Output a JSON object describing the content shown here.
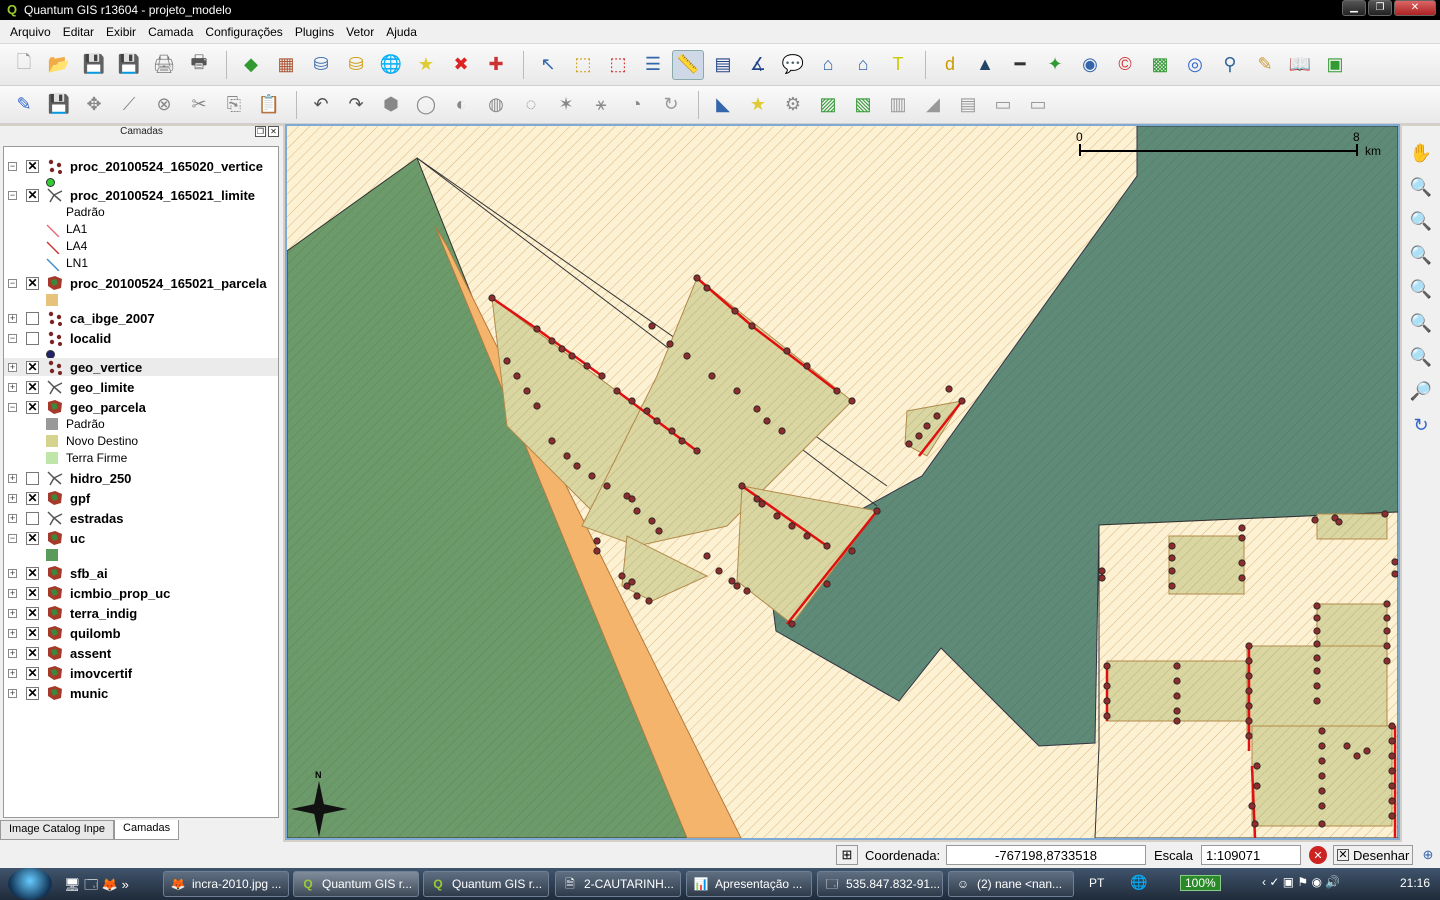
{
  "window": {
    "title": "Quantum GIS r13604 - projeto_modelo",
    "app_icon": "Q"
  },
  "menu": [
    "Arquivo",
    "Editar",
    "Exibir",
    "Camada",
    "Configurações",
    "Plugins",
    "Vetor",
    "Ajuda"
  ],
  "layers_panel": {
    "title": "Camadas",
    "layers": [
      {
        "name": "proc_20100524_165020_vertice",
        "checked": true,
        "expanded": true,
        "icon": "point"
      },
      {
        "name": "proc_20100524_165021_limite",
        "checked": true,
        "expanded": true,
        "icon": "line"
      },
      {
        "name": "proc_20100524_165021_parcela",
        "checked": true,
        "expanded": true,
        "icon": "polygon"
      },
      {
        "name": "ca_ibge_2007",
        "checked": false,
        "expanded": false,
        "icon": "point"
      },
      {
        "name": "localid",
        "checked": false,
        "expanded": true,
        "icon": "point"
      },
      {
        "name": "geo_vertice",
        "checked": true,
        "expanded": false,
        "icon": "point"
      },
      {
        "name": "geo_limite",
        "checked": true,
        "expanded": false,
        "icon": "line"
      },
      {
        "name": "geo_parcela",
        "checked": true,
        "expanded": true,
        "icon": "polygon"
      },
      {
        "name": "hidro_250",
        "checked": false,
        "expanded": false,
        "icon": "line"
      },
      {
        "name": "gpf",
        "checked": true,
        "expanded": false,
        "icon": "polygon"
      },
      {
        "name": "estradas",
        "checked": false,
        "expanded": false,
        "icon": "line"
      },
      {
        "name": "uc",
        "checked": true,
        "expanded": true,
        "icon": "polygon"
      },
      {
        "name": "sfb_ai",
        "checked": true,
        "expanded": false,
        "icon": "polygon"
      },
      {
        "name": "icmbio_prop_uc",
        "checked": true,
        "expanded": false,
        "icon": "polygon"
      },
      {
        "name": "terra_indig",
        "checked": true,
        "expanded": false,
        "icon": "polygon"
      },
      {
        "name": "quilomb",
        "checked": true,
        "expanded": false,
        "icon": "polygon"
      },
      {
        "name": "assent",
        "checked": true,
        "expanded": false,
        "icon": "polygon"
      },
      {
        "name": "imovcertif",
        "checked": true,
        "expanded": false,
        "icon": "polygon"
      },
      {
        "name": "munic",
        "checked": true,
        "expanded": false,
        "icon": "polygon"
      }
    ],
    "limite_classes": [
      "Padrão",
      "LA1",
      "LA4",
      "LN1"
    ],
    "parcela_classes": [
      "Padrão",
      "Novo Destino",
      "Terra Firme"
    ],
    "tabs": [
      "Image Catalog Inpe",
      "Camadas"
    ]
  },
  "map": {
    "scalebar_start": "0",
    "scalebar_end": "8",
    "scalebar_unit": "km",
    "north_label": "N"
  },
  "statusbar": {
    "coord_label": "Coordenada:",
    "coord_value": "-767198,8733518",
    "scale_label": "Escala",
    "scale_value": "1:109071",
    "render_label": "Desenhar"
  },
  "taskbar": {
    "apps": [
      "incra-2010.jpg ...",
      "Quantum GIS r...",
      "Quantum GIS r...",
      "2-CAUTARINH...",
      "Apresentação ...",
      "535.847.832-91...",
      "(2) nane <nan..."
    ],
    "lang": "PT",
    "battery": "100%",
    "time": "21:16"
  },
  "colors": {
    "green_area": "#6c9a6a",
    "teal_area": "#5f8a78",
    "sand_area": "#fdf0d0",
    "orange_strip": "#f4b46c",
    "parcel_fill": "#d8d6a0",
    "vertex": "#8b2d2d",
    "limit_red": "#e01010"
  }
}
